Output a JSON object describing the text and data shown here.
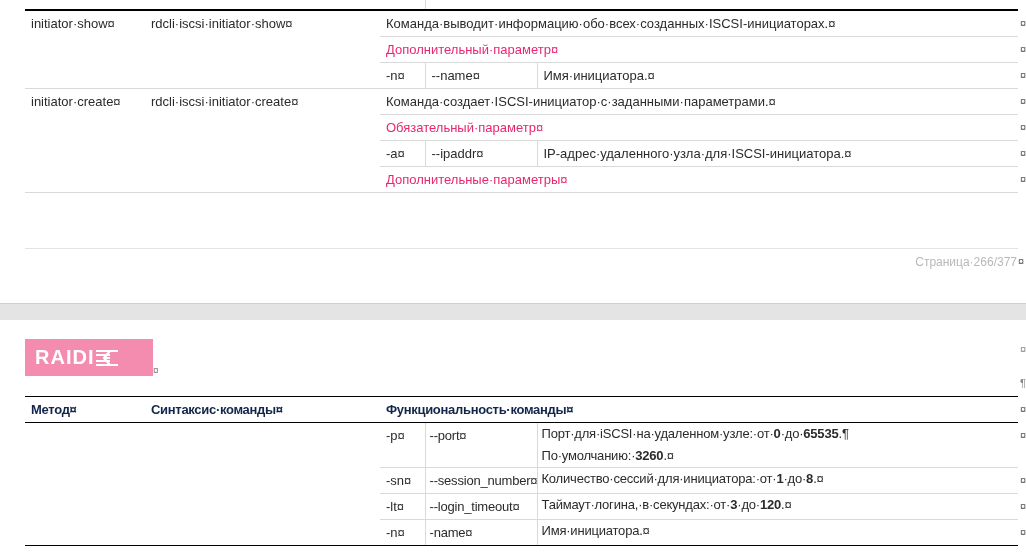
{
  "page_1": {
    "commands": [
      {
        "method": "initiator·show¤",
        "syntax": "rdcli·iscsi·initiator·show¤",
        "rows": [
          {
            "kind": "description",
            "text": "Команда·выводит·информацию·обо·всех·созданных·ISCSI-инициаторах.¤",
            "end_mark": "¤"
          },
          {
            "kind": "section",
            "text": "Дополнительный·параметр¤",
            "end_mark": "¤"
          },
          {
            "kind": "param",
            "short": "-n¤",
            "long": "--name¤",
            "lines": [
              "Имя·инициатора.¤"
            ],
            "end_mark": "¤"
          }
        ]
      },
      {
        "method": "initiator·create¤",
        "syntax": "rdcli·iscsi·initiator·create¤",
        "rows": [
          {
            "kind": "description",
            "text": "Команда·создает·ISCSI-инициатор·с·заданными·параметрами.¤",
            "end_mark": "¤"
          },
          {
            "kind": "section",
            "text": "Обязательный·параметр¤",
            "end_mark": "¤"
          },
          {
            "kind": "param",
            "short": "-a¤",
            "long": "--ipaddr¤",
            "lines": [
              "IP-адрес·удаленного·узла·для·ISCSI-инициатора.¤"
            ],
            "end_mark": "¤"
          },
          {
            "kind": "section",
            "text": "Дополнительные·параметры¤",
            "end_mark": "¤"
          }
        ]
      }
    ],
    "footer": {
      "page_number": "Страница·266/377",
      "end_mark": "¤"
    }
  },
  "page_2": {
    "logo": {
      "text": "RAIDI",
      "end_mark": "¤"
    },
    "margin_marks": [
      "¤",
      "¶"
    ],
    "header": {
      "columns": [
        "Метод¤",
        "Синтаксис·команды¤",
        "Функциональность·команды¤"
      ],
      "end_mark": "¤"
    },
    "rows": [
      {
        "kind": "param",
        "short": "-p¤",
        "long": "--port¤",
        "lines": [
          "Порт·для·iSCSI·на·удаленном·узле:·от·**0**·до·**65535**.¶",
          "По·умолчанию:·**3260**.¤"
        ],
        "end_mark": "¤"
      },
      {
        "kind": "param",
        "short": "-sn¤",
        "long": "--session_number¤",
        "lines": [
          "Количество·сессий·для·инициатора:·от·**1**·до·**8**.¤"
        ],
        "end_mark": "¤"
      },
      {
        "kind": "param",
        "short": "-lt¤",
        "long": "--login_timeout¤",
        "lines": [
          "Таймаут·логина,·в·секундах:·от·**3**·до·**120**.¤"
        ],
        "end_mark": "¤"
      },
      {
        "kind": "param",
        "short": "-n¤",
        "long": "-name¤",
        "lines": [
          "Имя·инициатора.¤"
        ],
        "end_mark": "¤"
      }
    ]
  }
}
